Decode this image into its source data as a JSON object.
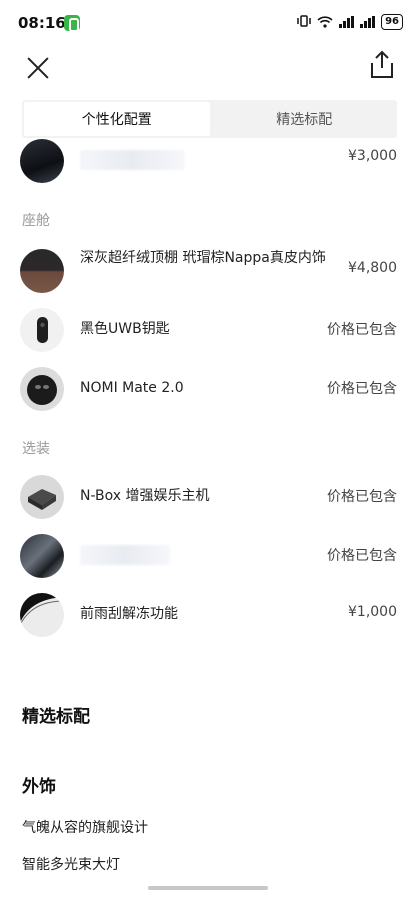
{
  "status": {
    "time": "08:16",
    "battery": "96"
  },
  "tabs": [
    {
      "label": "个性化配置",
      "active": true
    },
    {
      "label": "精选标配",
      "active": false
    }
  ],
  "items_top": {
    "price": "¥3,000"
  },
  "cabin": {
    "section_label": "座舱",
    "items": [
      {
        "name": "深灰超纤绒顶棚 玳瑁棕Nappa真皮内饰",
        "price": "¥4,800",
        "icon": "interior-swatch"
      },
      {
        "name": "黑色UWB钥匙",
        "price": "价格已包含",
        "icon": "key-fob"
      },
      {
        "name": "NOMI Mate 2.0",
        "price": "价格已包含",
        "icon": "nomi-device"
      }
    ]
  },
  "options": {
    "section_label": "选装",
    "items": [
      {
        "name": "N-Box 增强娱乐主机",
        "price": "价格已包含",
        "icon": "nbox-device"
      },
      {
        "name": "",
        "price": "价格已包含",
        "icon": "option-thumbnail"
      },
      {
        "name": "前雨刮解冻功能",
        "price": "¥1,000",
        "icon": "windshield"
      }
    ]
  },
  "standard": {
    "heading": "精选标配",
    "exterior_heading": "外饰",
    "exterior_items": [
      "气魄从容的旗舰设计",
      "智能多光束大灯"
    ]
  }
}
